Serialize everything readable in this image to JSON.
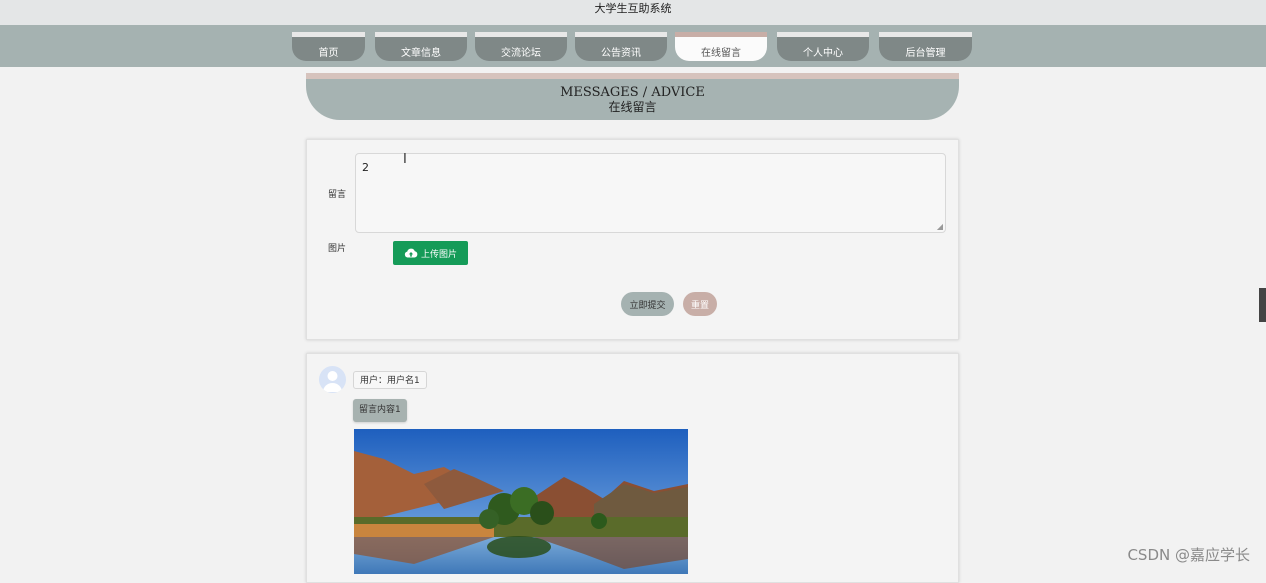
{
  "site": {
    "title": "大学生互助系统"
  },
  "nav": {
    "items": [
      {
        "label": "首页"
      },
      {
        "label": "文章信息"
      },
      {
        "label": "交流论坛"
      },
      {
        "label": "公告资讯"
      },
      {
        "label": "在线留言",
        "active": true
      },
      {
        "label": "个人中心"
      },
      {
        "label": "后台管理"
      }
    ]
  },
  "banner": {
    "title_en": "MESSAGES / ADVICE",
    "title_cn": "在线留言"
  },
  "form": {
    "message_label": "留言",
    "message_value": "2",
    "image_label": "图片",
    "upload_label": "上传图片",
    "submit_label": "立即提交",
    "reset_label": "重置"
  },
  "messages": [
    {
      "user": "用户：用户名1",
      "content": "留言内容1"
    }
  ],
  "watermark": "CSDN @嘉应学长",
  "colors": {
    "nav_bar": "#a5b2b1",
    "nav_item": "#7f8887",
    "upload_green": "#159b58",
    "submit": "#a5b2b1",
    "reset": "#c8aea7"
  }
}
